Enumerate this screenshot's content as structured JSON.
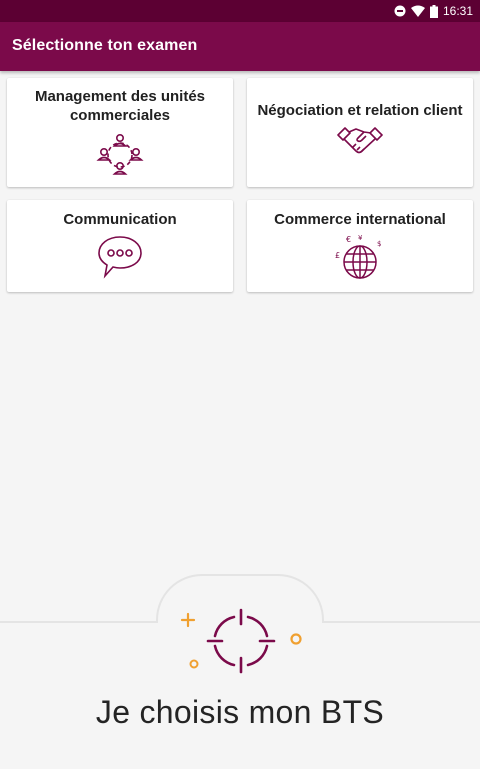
{
  "status_bar": {
    "time": "16:31"
  },
  "app_bar": {
    "title": "Sélectionne ton examen"
  },
  "cards": [
    {
      "label": "Management des unités commerciales",
      "icon": "team-network-icon"
    },
    {
      "label": "Négociation et relation client",
      "icon": "handshake-icon"
    },
    {
      "label": "Communication",
      "icon": "speech-bubble-icon"
    },
    {
      "label": "Commerce international",
      "icon": "globe-currency-icon"
    }
  ],
  "footer": {
    "title": "Je choisis mon BTS"
  },
  "colors": {
    "brand": "#7b0a4a",
    "brand_dark": "#5c0033",
    "accent": "#f0a030",
    "icon": "#7b0a4a"
  }
}
